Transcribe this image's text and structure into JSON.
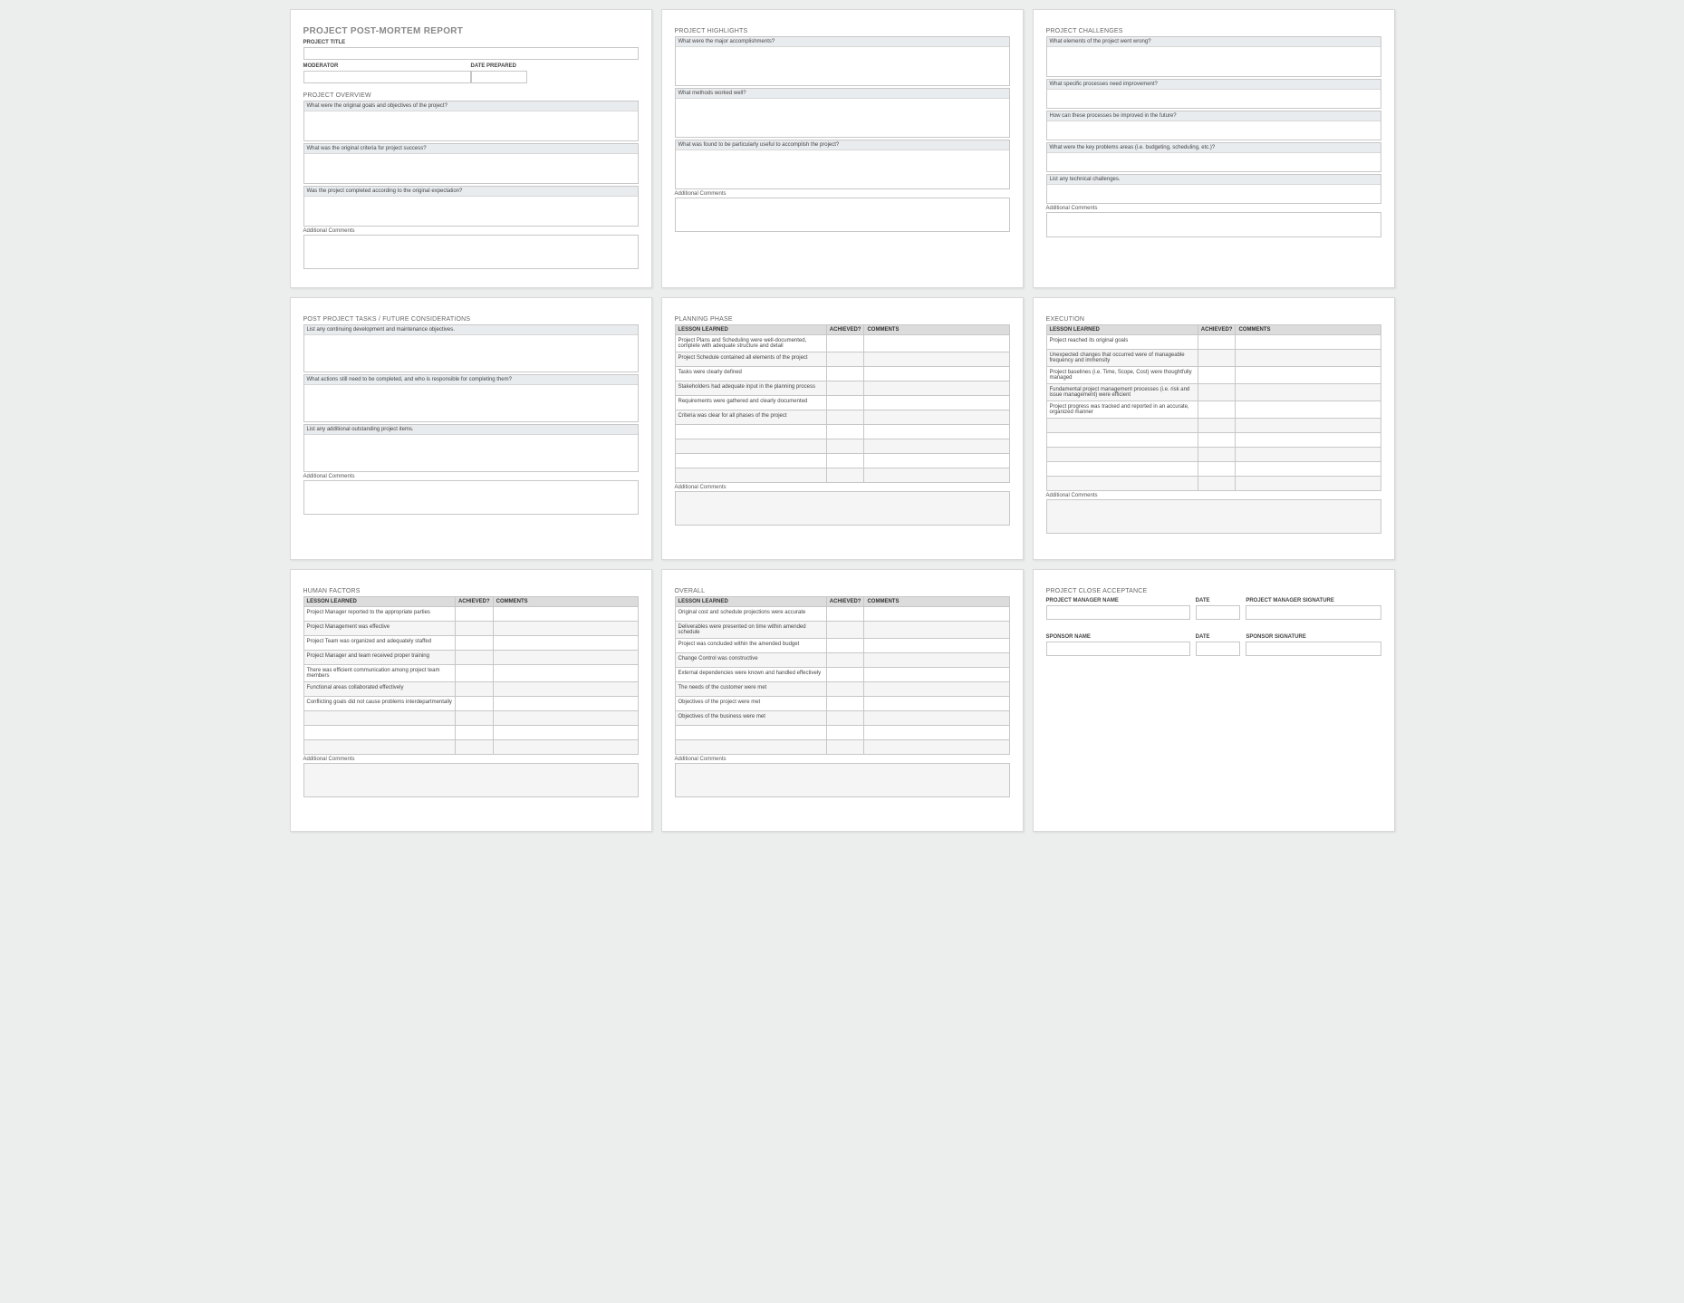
{
  "card1": {
    "title": "PROJECT POST-MORTEM REPORT",
    "project_title_lbl": "PROJECT TITLE",
    "moderator_lbl": "MODERATOR",
    "date_prepared_lbl": "DATE PREPARED",
    "overview_title": "PROJECT OVERVIEW",
    "q1": "What were the original goals and objectives of the project?",
    "q2": "What was the original criteria for project success?",
    "q3": "Was the project completed according to the original expectation?",
    "addl": "Additional Comments"
  },
  "card2": {
    "title": "PROJECT HIGHLIGHTS",
    "q1": "What were the major accomplishments?",
    "q2": "What methods worked well?",
    "q3": "What was found to be particularly useful to accomplish the project?",
    "addl": "Additional Comments"
  },
  "card3": {
    "title": "PROJECT CHALLENGES",
    "q1": "What elements of the project went wrong?",
    "q2": "What specific processes need improvement?",
    "q3": "How can these processes be improved in the future?",
    "q4": "What were the key problems areas (i.e. budgeting, scheduling, etc.)?",
    "q5": "List any technical challenges.",
    "addl": "Additional Comments"
  },
  "card4": {
    "title": "POST PROJECT TASKS / FUTURE CONSIDERATIONS",
    "q1": "List any continuing development and maintenance objectives.",
    "q2": "What actions still need to be completed, and who is responsible for completing them?",
    "q3": "List any additional outstanding project items.",
    "addl": "Additional Comments"
  },
  "tableHeaders": {
    "ll": "LESSON LEARNED",
    "ac": "ACHIEVED?",
    "cm": "COMMENTS"
  },
  "card5": {
    "title": "PLANNING PHASE",
    "rows": [
      "Project Plans and Scheduling were well-documented, complete with adequate structure and detail",
      "Project Schedule contained all elements of the project",
      "Tasks were clearly defined",
      "Stakeholders had adequate input in the planning process",
      "Requirements were gathered and clearly documented",
      "Criteria was clear for all phases of the project",
      "",
      "",
      "",
      ""
    ],
    "addl": "Additional Comments"
  },
  "card6": {
    "title": "EXECUTION",
    "rows": [
      "Project reached its original goals",
      "Unexpected changes that occurred were of manageable frequency and immensity",
      "Project baselines (i.e. Time, Scope, Cost) were thoughtfully managed",
      "Fundamental project management processes (i.e. risk and issue management) were efficient",
      "Project progress was tracked and reported in an accurate, organized manner",
      "",
      "",
      "",
      "",
      ""
    ],
    "addl": "Additional Comments"
  },
  "card7": {
    "title": "HUMAN FACTORS",
    "rows": [
      "Project Manager reported to the appropriate parties",
      "Project Management was effective",
      "Project Team was organized and adequately staffed",
      "Project Manager and team received proper training",
      "There was efficient communication among project team members",
      "Functional areas collaborated effectively",
      "Conflicting goals did not cause problems interdepartmentally",
      "",
      "",
      ""
    ],
    "addl": "Additional Comments"
  },
  "card8": {
    "title": "OVERALL",
    "rows": [
      "Original cost and schedule projections were accurate",
      "Deliverables were presented on time within amended schedule",
      "Project was concluded within the amended budget",
      "Change Control was constructive",
      "External dependencies were known and handled effectively",
      "The needs of the customer were met",
      "Objectives of the project were met",
      "Objectives of the business were met",
      "",
      ""
    ],
    "addl": "Additional Comments"
  },
  "card9": {
    "title": "PROJECT CLOSE ACCEPTANCE",
    "pm_name": "PROJECT MANAGER NAME",
    "date": "DATE",
    "pm_sig": "PROJECT MANAGER SIGNATURE",
    "sp_name": "SPONSOR NAME",
    "sp_sig": "SPONSOR SIGNATURE"
  }
}
